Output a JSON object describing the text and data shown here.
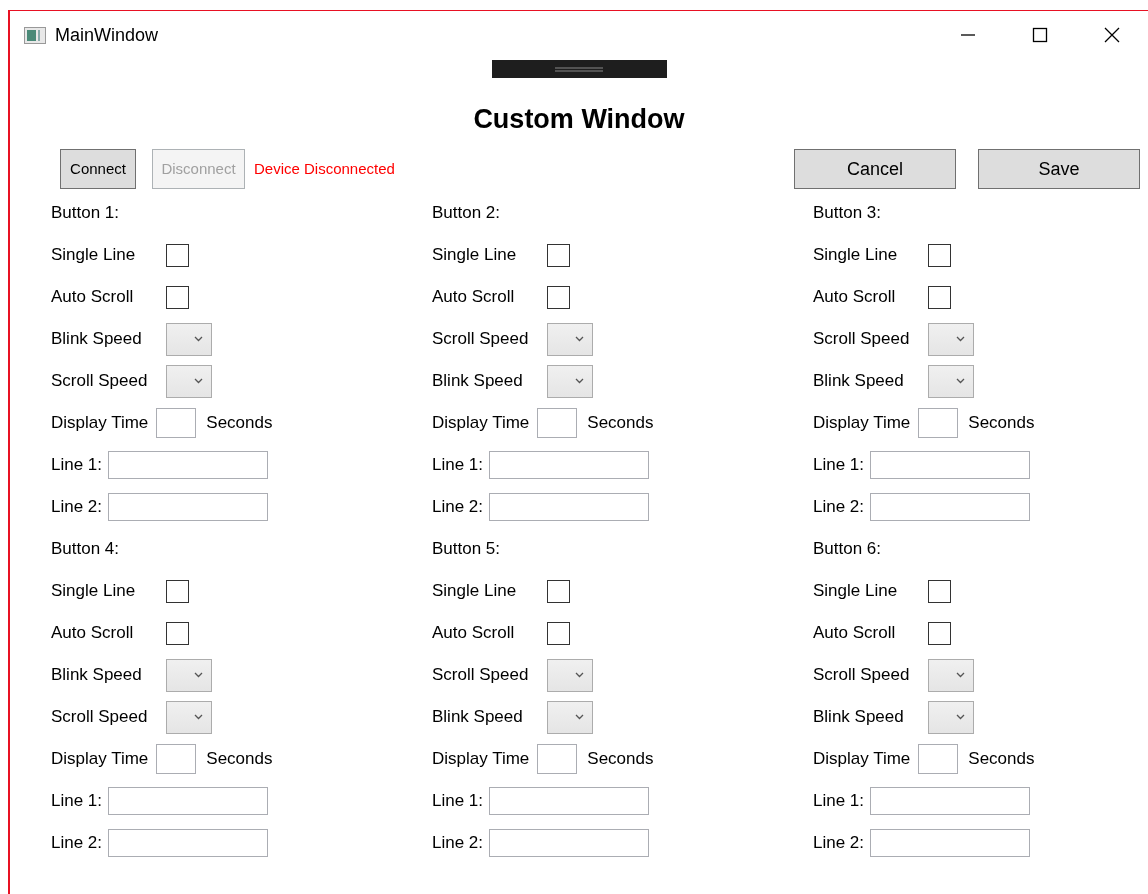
{
  "window": {
    "title": "MainWindow"
  },
  "heading": "Custom Window",
  "toolbar": {
    "connect": {
      "label": "Connect",
      "disabled": false
    },
    "disconnect": {
      "label": "Disconnect",
      "disabled": true
    },
    "status": "Device Disconnected",
    "cancel": "Cancel",
    "save": "Save"
  },
  "panels": [
    {
      "title": "Button 1:",
      "rows": [
        {
          "kind": "checkbox",
          "label": "Single Line",
          "checked": false
        },
        {
          "kind": "checkbox",
          "label": "Auto Scroll",
          "checked": false
        },
        {
          "kind": "dropdown",
          "label": "Blink Speed"
        },
        {
          "kind": "dropdown",
          "label": "Scroll Speed"
        },
        {
          "kind": "time",
          "label": "Display Time",
          "suffix": "Seconds"
        },
        {
          "kind": "text",
          "label": "Line 1:"
        },
        {
          "kind": "text",
          "label": "Line 2:"
        }
      ]
    },
    {
      "title": "Button 2:",
      "rows": [
        {
          "kind": "checkbox",
          "label": "Single Line",
          "checked": false
        },
        {
          "kind": "checkbox",
          "label": "Auto Scroll",
          "checked": false
        },
        {
          "kind": "dropdown",
          "label": "Scroll Speed"
        },
        {
          "kind": "dropdown",
          "label": "Blink Speed"
        },
        {
          "kind": "time",
          "label": "Display Time",
          "suffix": "Seconds"
        },
        {
          "kind": "text",
          "label": "Line 1:"
        },
        {
          "kind": "text",
          "label": "Line 2:"
        }
      ]
    },
    {
      "title": "Button 3:",
      "rows": [
        {
          "kind": "checkbox",
          "label": "Single Line",
          "checked": false
        },
        {
          "kind": "checkbox",
          "label": "Auto Scroll",
          "checked": false
        },
        {
          "kind": "dropdown",
          "label": "Scroll Speed"
        },
        {
          "kind": "dropdown",
          "label": "Blink Speed"
        },
        {
          "kind": "time",
          "label": "Display Time",
          "suffix": "Seconds"
        },
        {
          "kind": "text",
          "label": "Line 1:"
        },
        {
          "kind": "text",
          "label": "Line 2:"
        }
      ]
    },
    {
      "title": "Button 4:",
      "rows": [
        {
          "kind": "checkbox",
          "label": "Single Line",
          "checked": false
        },
        {
          "kind": "checkbox",
          "label": "Auto Scroll",
          "checked": false
        },
        {
          "kind": "dropdown",
          "label": "Blink Speed"
        },
        {
          "kind": "dropdown",
          "label": "Scroll Speed"
        },
        {
          "kind": "time",
          "label": "Display Time",
          "suffix": "Seconds"
        },
        {
          "kind": "text",
          "label": "Line 1:"
        },
        {
          "kind": "text",
          "label": "Line 2:"
        }
      ]
    },
    {
      "title": "Button 5:",
      "rows": [
        {
          "kind": "checkbox",
          "label": "Single Line",
          "checked": false
        },
        {
          "kind": "checkbox",
          "label": "Auto Scroll",
          "checked": false
        },
        {
          "kind": "dropdown",
          "label": "Scroll Speed"
        },
        {
          "kind": "dropdown",
          "label": "Blink Speed"
        },
        {
          "kind": "time",
          "label": "Display Time",
          "suffix": "Seconds"
        },
        {
          "kind": "text",
          "label": "Line 1:"
        },
        {
          "kind": "text",
          "label": "Line 2:"
        }
      ]
    },
    {
      "title": "Button 6:",
      "rows": [
        {
          "kind": "checkbox",
          "label": "Single Line",
          "checked": false
        },
        {
          "kind": "checkbox",
          "label": "Auto Scroll",
          "checked": false
        },
        {
          "kind": "dropdown",
          "label": "Scroll Speed"
        },
        {
          "kind": "dropdown",
          "label": "Blink Speed"
        },
        {
          "kind": "time",
          "label": "Display Time",
          "suffix": "Seconds"
        },
        {
          "kind": "text",
          "label": "Line 1:"
        },
        {
          "kind": "text",
          "label": "Line 2:"
        }
      ]
    }
  ]
}
